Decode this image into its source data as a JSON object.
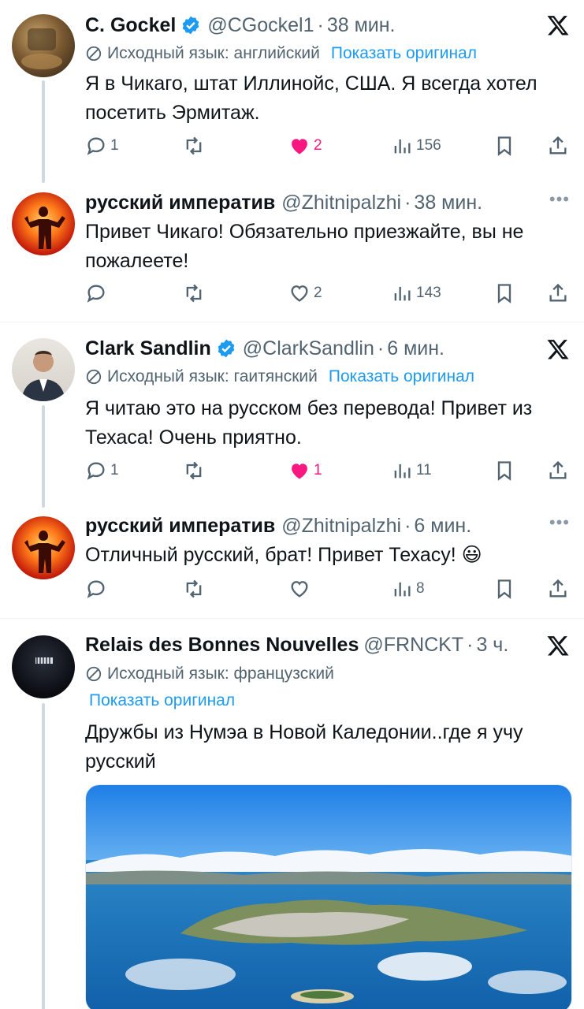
{
  "colors": {
    "accent": "#1d9bf0",
    "like": "#f91880",
    "muted": "#536471"
  },
  "tweets": [
    {
      "name": "C. Gockel",
      "handle": "@CGockel1",
      "time": "38 мин.",
      "translate_label": "Исходный язык: английский",
      "show_original": "Показать оригинал",
      "text": "Я в Чикаго, штат Иллинойс, США. Я всегда хотел посетить Эрмитаж.",
      "replies": "1",
      "likes": "2",
      "views": "156"
    },
    {
      "name": "русский императив",
      "handle": "@Zhitnipalzhi",
      "time": "38 мин.",
      "text": "Привет Чикаго! Обязательно приезжайте, вы не пожалеете!",
      "likes": "2",
      "views": "143"
    },
    {
      "name": "Clark Sandlin",
      "handle": "@ClarkSandlin",
      "time": "6 мин.",
      "translate_label": "Исходный язык: гаитянский",
      "show_original": "Показать оригинал",
      "text": "Я читаю это на русском без перевода! Привет из Техаса! Очень приятно.",
      "replies": "1",
      "likes": "1",
      "views": "11"
    },
    {
      "name": "русский императив",
      "handle": "@Zhitnipalzhi",
      "time": "6 мин.",
      "text": "Отличный русский, брат! Привет Техасу! 😃",
      "views": "8"
    },
    {
      "name": "Relais des Bonnes Nouvelles",
      "handle": "@FRNCKT",
      "time": "3 ч.",
      "translate_label": "Исходный язык: французский",
      "show_original": "Показать оригинал",
      "text": "Дружбы из Нумэа в Новой Каледонии..где я учу русский"
    }
  ]
}
